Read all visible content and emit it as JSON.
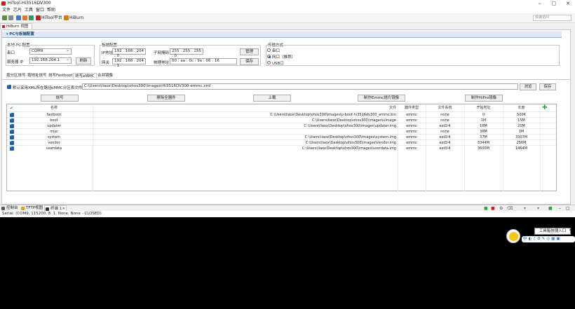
{
  "window": {
    "title": "HiTool-Hi3516DV300"
  },
  "menu": [
    "文件",
    "芯片",
    "工具",
    "窗口",
    "帮助"
  ],
  "toolbar": {
    "hitool_platform": "HiTool平台",
    "hiburn": "HiBurn",
    "quick_access_placeholder": "快速访问"
  },
  "editor_tab": {
    "label": "HiBurn 视图"
  },
  "pc_section": {
    "title": "PC与板端配置",
    "local_pc": {
      "heading": "本地 PC 配置",
      "port_label": "串口",
      "port_value": "COM9",
      "server_ip_label": "服务器 IP",
      "server_ip_value": "192.168.204.1",
      "refresh": "刷新"
    },
    "board": {
      "heading": "板端配置",
      "ip_label": "IP地址",
      "ip_value": "192 . 168 . 204 . 0",
      "mask_label": "子网掩码",
      "mask_value": "255 . 255 . 255 . 0",
      "gateway_label": "网关",
      "gateway_value": "192 . 168 . 204 . 1",
      "mac_label": "物理地址",
      "mac_value": "00 : aa : 0c : 9a : 06 : 16",
      "manage": "管理",
      "save": "保存"
    },
    "transfer": {
      "heading": "传输方式",
      "options": [
        "串口",
        "网口（推荐）",
        "USB口"
      ],
      "selected": 1
    }
  },
  "subtabs": [
    "按分区烧写",
    "按地址烧写",
    "烧写Fastboot",
    "烧写eMMC",
    "合并镜像"
  ],
  "active_subtab": 3,
  "xml": {
    "checkbox_label": "默认采用XML所在路径",
    "file_label": "eMMC分区表文件",
    "file_value": "C:\\Users\\liaox\\Desktop\\ohos300\\images\\Hi3516DV300-emmc.xml",
    "browse": "浏览",
    "save": "保存"
  },
  "actions": {
    "burn": "烧写",
    "erase_all": "擦除全器件",
    "upload": "上载",
    "make_emmc": "制作Emmc烧片镜像",
    "make_hipro": "制作HiPro镜像"
  },
  "table": {
    "columns": [
      "名称",
      "文件",
      "器件类型",
      "文件系统",
      "开始地址",
      "长度"
    ],
    "rows": [
      {
        "name": "fastboot",
        "file": "C:\\Users\\liaox\\Desktop\\ohos300\\images\\u-boot-hi3516dv300_emmc.bin",
        "device": "emmc",
        "fs": "none",
        "start": "0",
        "length": "500K"
      },
      {
        "name": "boot",
        "file": "C:\\Users\\liaox\\Desktop\\ohos300\\images\\uImage",
        "device": "emmc",
        "fs": "none",
        "start": "1M",
        "length": "15M"
      },
      {
        "name": "updater",
        "file": "C:\\Users\\liaox\\Desktop\\ohos300\\images\\updater.img",
        "device": "emmc",
        "fs": "ext3/4",
        "start": "16M",
        "length": "20M"
      },
      {
        "name": "misc",
        "file": "",
        "device": "emmc",
        "fs": "none",
        "start": "36M",
        "length": "1M"
      },
      {
        "name": "system",
        "file": "C:\\Users\\liaox\\Desktop\\ohos300\\images\\system.img",
        "device": "emmc",
        "fs": "ext3/4",
        "start": "37M",
        "length": "3307M"
      },
      {
        "name": "vendor",
        "file": "C:\\Users\\liaox\\Desktop\\ohos300\\images\\vendor.img",
        "device": "emmc",
        "fs": "ext3/4",
        "start": "3344M",
        "length": "256M"
      },
      {
        "name": "userdata",
        "file": "C:\\Users\\liaox\\Desktop\\ohos300\\images\\userdata.img",
        "device": "emmc",
        "fs": "ext3/4",
        "start": "3600M",
        "length": "1464M"
      }
    ]
  },
  "console": {
    "tabs": [
      "控制台",
      "TFTP视图",
      "终端 1"
    ],
    "status": "Serial: (COM9, 115200, 8, 1, None, None - CLOSED)"
  },
  "widget": {
    "tooltip": "工具箱快捷入口"
  },
  "colors": {
    "accent": "#1a5fb4",
    "brand": "#c8201e",
    "console_bg": "#000000",
    "add_green": "#2ea043"
  }
}
